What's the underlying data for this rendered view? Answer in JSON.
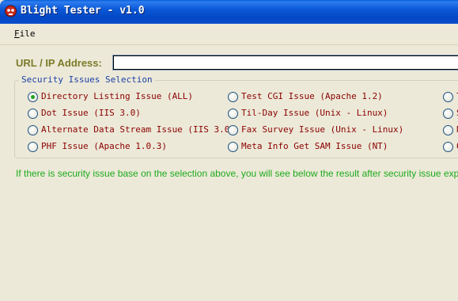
{
  "window": {
    "title": "Blight Tester - v1.0",
    "icon": "skull-icon"
  },
  "menu": {
    "file_label": "File",
    "file_accel": "F",
    "file_rest": "ile"
  },
  "url": {
    "label": "URL / IP Address:",
    "value": ""
  },
  "group": {
    "title": "Security Issues Selection"
  },
  "options": [
    {
      "label": "Directory Listing Issue (ALL)",
      "selected": true
    },
    {
      "label": "Dot Issue (IIS 3.0)",
      "selected": false
    },
    {
      "label": "Alternate Data Stream Issue (IIS 3.0)",
      "selected": false
    },
    {
      "label": "PHF Issue (Apache 1.0.3)",
      "selected": false
    },
    {
      "label": "Test CGI Issue (Apache 1.2)",
      "selected": false
    },
    {
      "label": "Til-Day Issue (Unix - Linux)",
      "selected": false
    },
    {
      "label": "Fax Survey Issue (Unix - Linux)",
      "selected": false
    },
    {
      "label": "Meta Info Get SAM Issue (NT)",
      "selected": false
    },
    {
      "label": "T",
      "selected": false
    },
    {
      "label": "S",
      "selected": false
    },
    {
      "label": "N",
      "selected": false
    },
    {
      "label": "O",
      "selected": false
    }
  ],
  "info": "If there is security issue base on the selection above, you will see below the result after security issue exp"
}
